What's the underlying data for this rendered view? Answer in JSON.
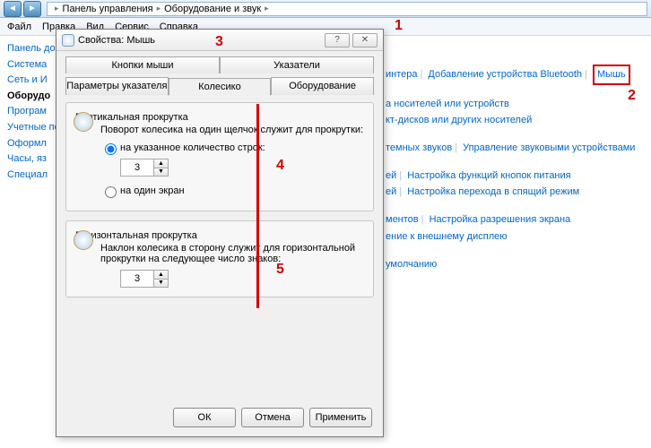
{
  "breadcrumb": {
    "item1": "Панель управления",
    "item2": "Оборудование и звук"
  },
  "menu": {
    "file": "Файл",
    "edit": "Правка",
    "view": "Вид",
    "service": "Сервис",
    "help": "Справка"
  },
  "sidebar": {
    "items": [
      "Панель домашн",
      "Система",
      "Сеть и И",
      "Оборудо",
      "Програм",
      "Учетные пользов безопас",
      "Оформл",
      "Часы, яз",
      "Специал"
    ],
    "active_index": 3
  },
  "right": {
    "row0": {
      "a": "интера",
      "b": "Добавление устройства Bluetooth",
      "c": "Мышь"
    },
    "row1": {
      "a": "а носителей или устройств",
      "b": "кт-дисков или других носителей"
    },
    "row2": {
      "a": "темных звуков",
      "b": "Управление звуковыми устройствами"
    },
    "row3": {
      "a": "ей",
      "b": "Настройка функций кнопок питания",
      "c": "ей",
      "d": "Настройка перехода в спящий режим"
    },
    "row4": {
      "a": "ментов",
      "b": "Настройка разрешения экрана",
      "c": "ение к внешнему дисплею"
    },
    "row5": {
      "a": "умолчанию"
    }
  },
  "dialog": {
    "title": "Свойства: Мышь",
    "tabs": {
      "buttons": "Кнопки мыши",
      "pointers": "Указатели",
      "pointer_opts": "Параметры указателя",
      "wheel": "Колесико",
      "hardware": "Оборудование"
    },
    "group_v": {
      "legend": "Вертикальная прокрутка",
      "desc": "Поворот колесика на один щелчок служит для прокрутки:",
      "radio_lines": "на указанное количество строк:",
      "lines_value": "3",
      "radio_screen": "на один экран"
    },
    "group_h": {
      "legend": "Горизонтальная прокрутка",
      "desc": "Наклон колесика в сторону служит для горизонтальной прокрутки на следующее число знаков:",
      "chars_value": "3"
    },
    "buttons": {
      "ok": "ОК",
      "cancel": "Отмена",
      "apply": "Применить"
    }
  },
  "anno": {
    "n1": "1",
    "n2": "2",
    "n3": "3",
    "n4": "4",
    "n5": "5"
  }
}
